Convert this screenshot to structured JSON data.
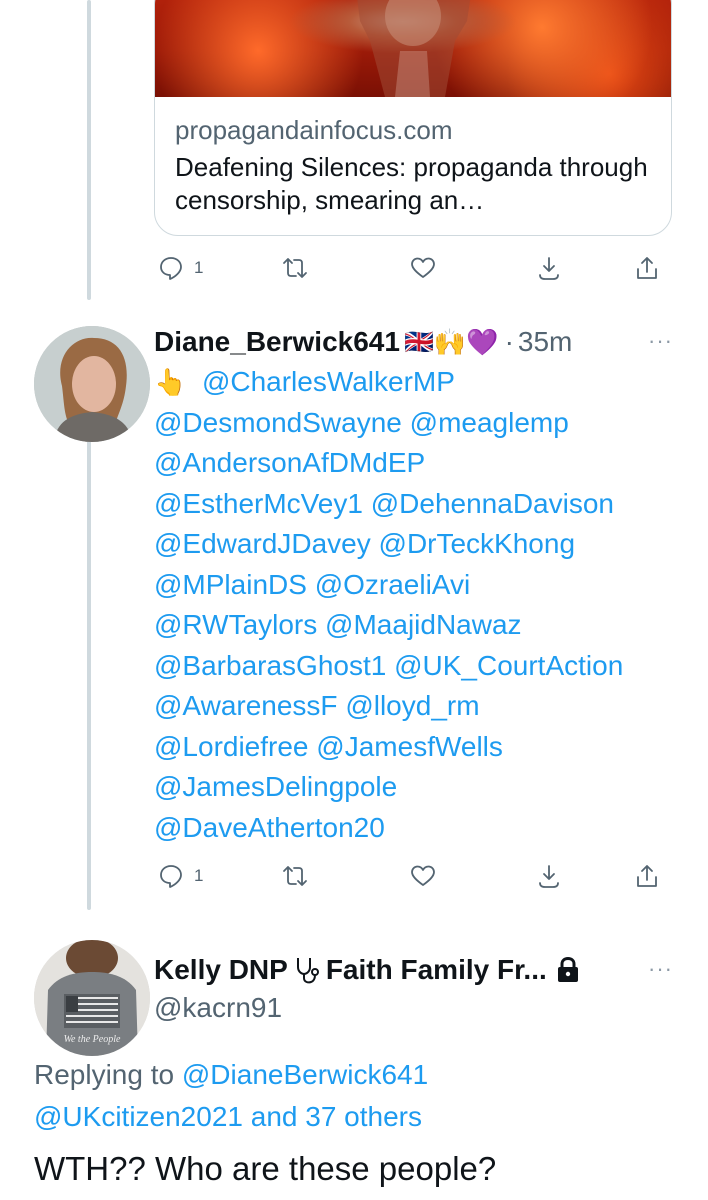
{
  "link_card": {
    "domain": "propagandainfocus.com",
    "title": "Deafening Silences: propaganda through censorship, smearing an…"
  },
  "actions1": {
    "reply_count": "1"
  },
  "tweet2": {
    "name": "Diane_Berwick641",
    "emoji_flag": "🇬🇧",
    "emoji_hands": "🙌",
    "emoji_heart": "💜",
    "separator": "·",
    "time": "35m",
    "pointer": "👆",
    "lines": [
      [
        "@CharlesWalkerMP"
      ],
      [
        "@DesmondSwayne",
        "@meaglemp"
      ],
      [
        "@AndersonAfDMdEP"
      ],
      [
        "@EstherMcVey1",
        "@DehennaDavison"
      ],
      [
        "@EdwardJDavey",
        "@DrTeckKhong"
      ],
      [
        "@MPlainDS",
        "@OzraeliAvi"
      ],
      [
        "@RWTaylors",
        "@MaajidNawaz"
      ],
      [
        "@BarbarasGhost1",
        "@UK_CourtAction"
      ],
      [
        "@AwarenessF",
        "@lloyd_rm"
      ],
      [
        "@Lordiefree",
        "@JamesfWells"
      ],
      [
        "@JamesDelingpole"
      ],
      [
        "@DaveAtherton20"
      ]
    ]
  },
  "actions2": {
    "reply_count": "1"
  },
  "tweet3": {
    "name_prefix": "Kelly DNP",
    "name_suffix": "Faith Family Fr...",
    "handle": "@kacrn91",
    "replying_to_label": "Replying to",
    "replying_to_user": "@DianeBerwick641",
    "replying_to_user2": "@UKcitizen2021",
    "replying_to_rest": "and 37 others",
    "text": "WTH?? Who are these people?",
    "shirt_text": "We the People"
  },
  "more_label": "···",
  "colors": {
    "accent": "#1d9bf0",
    "muted": "#536471",
    "border": "#cfd9de"
  },
  "icons": [
    "reply-icon",
    "retweet-icon",
    "like-icon",
    "bookmark-icon",
    "share-icon",
    "stethoscope-icon",
    "lock-icon",
    "more-icon"
  ]
}
